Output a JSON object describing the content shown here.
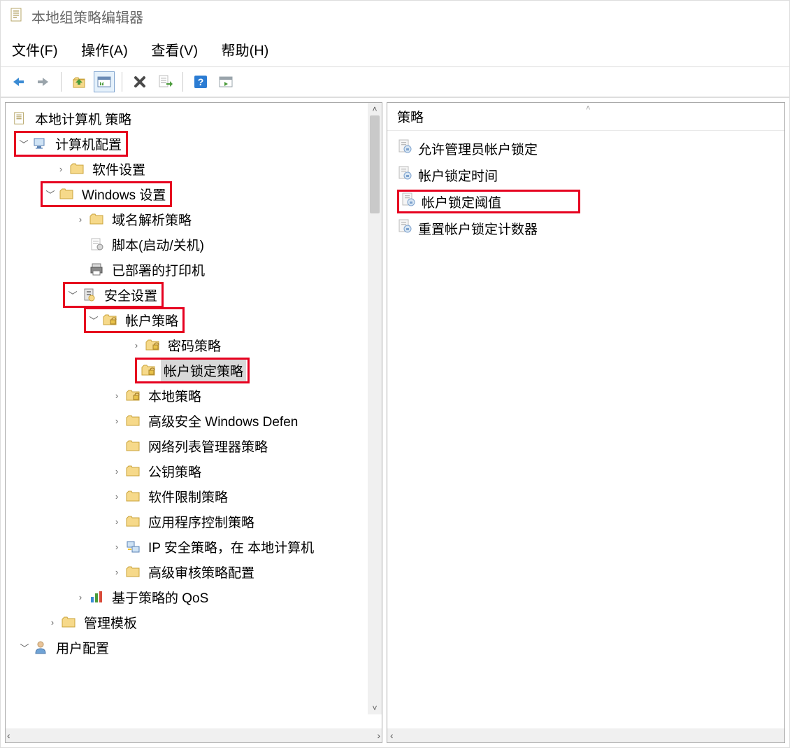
{
  "window": {
    "title": "本地组策略编辑器"
  },
  "menu": {
    "file": "文件(F)",
    "action": "操作(A)",
    "view": "查看(V)",
    "help": "帮助(H)"
  },
  "tree": {
    "root": "本地计算机 策略",
    "computer_config": "计算机配置",
    "software_settings": "软件设置",
    "windows_settings": "Windows 设置",
    "dns_policy": "域名解析策略",
    "scripts": "脚本(启动/关机)",
    "deployed_printers": "已部署的打印机",
    "security_settings": "安全设置",
    "account_policies": "帐户策略",
    "password_policy": "密码策略",
    "account_lockout_policy": "帐户锁定策略",
    "local_policies": "本地策略",
    "wdf": "高级安全 Windows Defen",
    "network_list": "网络列表管理器策略",
    "public_key": "公钥策略",
    "software_restriction": "软件限制策略",
    "app_control": "应用程序控制策略",
    "ip_sec": "IP 安全策略，在 本地计算机",
    "adv_audit": "高级审核策略配置",
    "qos": "基于策略的 QoS",
    "admin_templates": "管理模板",
    "user_config": "用户配置"
  },
  "list": {
    "header": "策略",
    "items": [
      "允许管理员帐户锁定",
      "帐户锁定时间",
      "帐户锁定阈值",
      "重置帐户锁定计数器"
    ]
  },
  "colors": {
    "highlight": "#e6001f",
    "selected_bg": "#d8d8d8"
  }
}
